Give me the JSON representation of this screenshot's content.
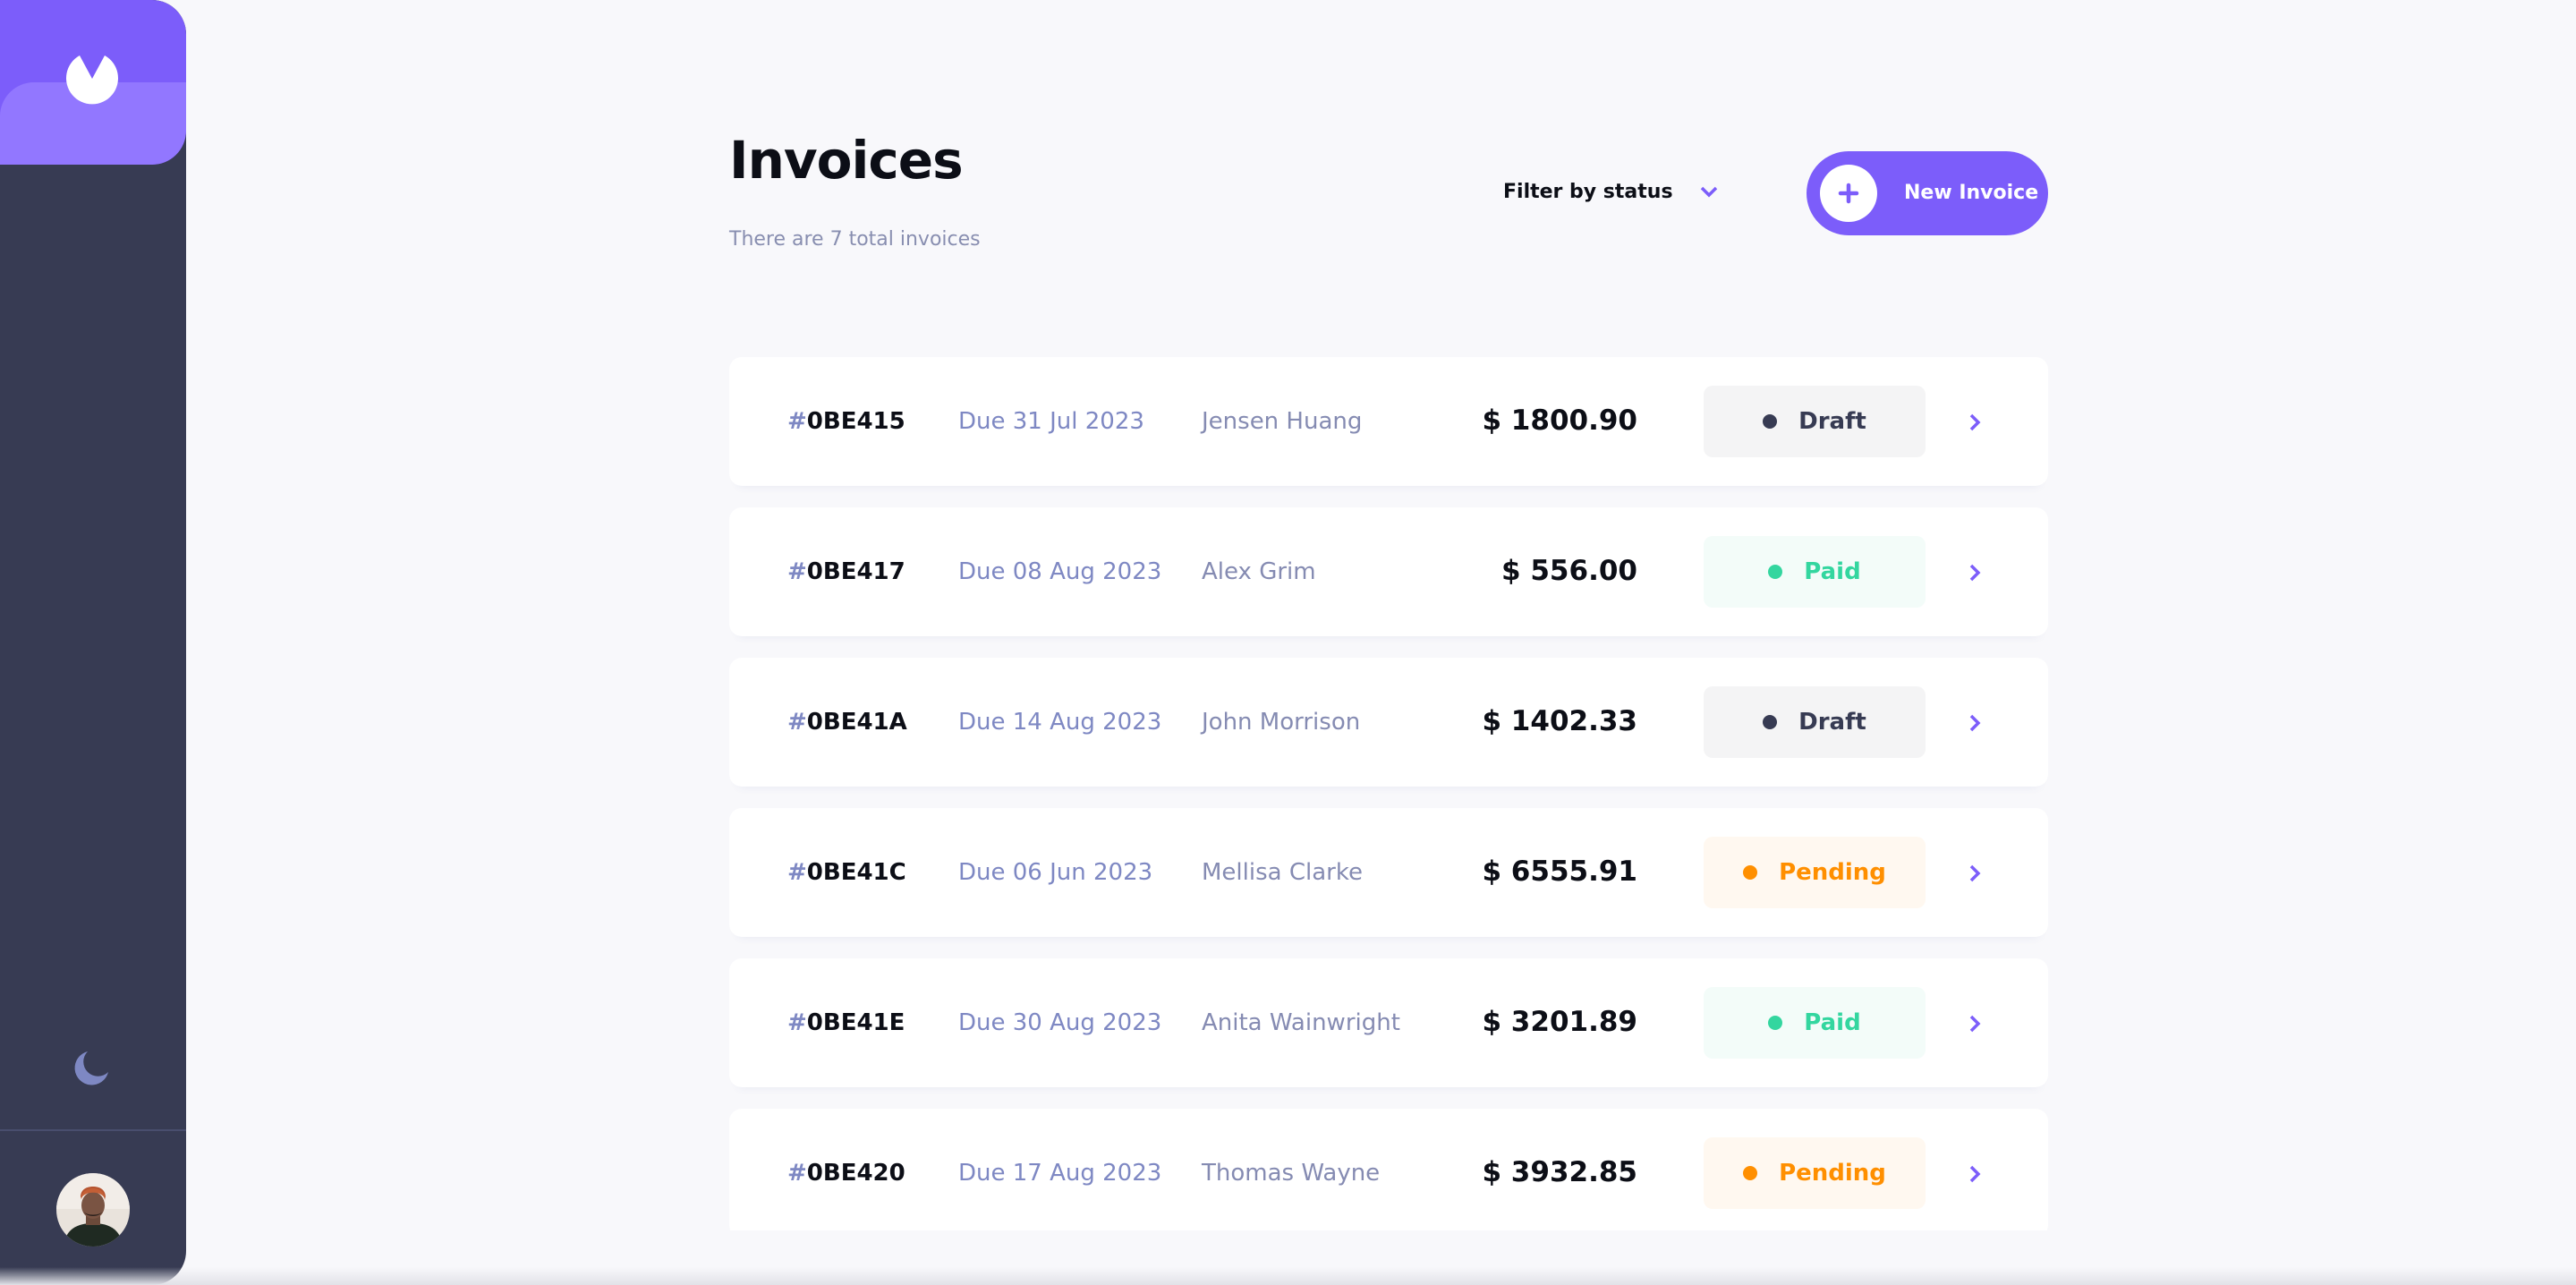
{
  "header": {
    "title": "Invoices",
    "subtitle": "There are 7 total invoices",
    "filter_label": "Filter by status",
    "new_invoice_label": "New Invoice"
  },
  "colors": {
    "accent": "#7c5dfa",
    "accent_light": "#9277ff",
    "sidebar": "#373b53",
    "paid": "#33d69f",
    "pending": "#ff8f00",
    "draft": "#373b53"
  },
  "icons": {
    "logo": "app-logo-icon",
    "theme": "moon-icon",
    "filter": "chevron-down-icon",
    "new": "plus-icon",
    "row": "chevron-right-icon"
  },
  "invoices": [
    {
      "hash": "#",
      "id": "0BE415",
      "due": "Due 31 Jul 2023",
      "client": "Jensen Huang",
      "amount": "$ 1800.90",
      "status": "Draft",
      "status_key": "draft"
    },
    {
      "hash": "#",
      "id": "0BE417",
      "due": "Due 08 Aug 2023",
      "client": "Alex Grim",
      "amount": "$ 556.00",
      "status": "Paid",
      "status_key": "paid"
    },
    {
      "hash": "#",
      "id": "0BE41A",
      "due": "Due 14 Aug 2023",
      "client": "John Morrison",
      "amount": "$ 1402.33",
      "status": "Draft",
      "status_key": "draft"
    },
    {
      "hash": "#",
      "id": "0BE41C",
      "due": "Due 06 Jun 2023",
      "client": "Mellisa Clarke",
      "amount": "$ 6555.91",
      "status": "Pending",
      "status_key": "pending"
    },
    {
      "hash": "#",
      "id": "0BE41E",
      "due": "Due 30 Aug 2023",
      "client": "Anita Wainwright",
      "amount": "$ 3201.89",
      "status": "Paid",
      "status_key": "paid"
    },
    {
      "hash": "#",
      "id": "0BE420",
      "due": "Due 17 Aug 2023",
      "client": "Thomas Wayne",
      "amount": "$ 3932.85",
      "status": "Pending",
      "status_key": "pending"
    }
  ]
}
